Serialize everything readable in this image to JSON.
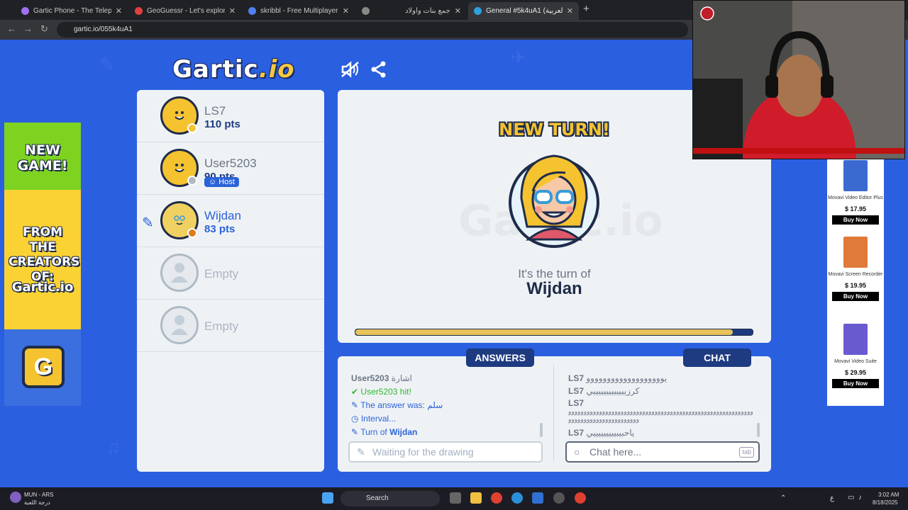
{
  "browser": {
    "tabs": [
      {
        "title": "Gartic Phone - The Telephone G",
        "color": "#a070f0"
      },
      {
        "title": "GeoGuessr - Let's explore the w",
        "color": "#e04040"
      },
      {
        "title": "skribbl - Free Multiplayer Draw",
        "color": "#5080f0"
      },
      {
        "title": "",
        "color": "#888888"
      },
      {
        "title": "جمع بنات وأولاد",
        "color": ""
      },
      {
        "title": "General #5k4uA1 (العربية) - Gar",
        "color": "#30a0e0"
      }
    ],
    "url": "gartic.io/055k4uA1"
  },
  "logo": {
    "text": "Gartic",
    "io": ".io"
  },
  "players": [
    {
      "name": "LS7",
      "points": "110 pts",
      "status_color": "#f5c230"
    },
    {
      "name": "User5203",
      "points": "90 pts",
      "status_color": "#b0b8c0",
      "badge": "Host"
    },
    {
      "name": "Wijdan",
      "points": "83 pts",
      "status_color": "#e07a1a"
    },
    {
      "name": "Empty"
    },
    {
      "name": "Empty"
    }
  ],
  "stage": {
    "headline": "NEW TURN!",
    "turn_of_label": "It's the turn of",
    "turn_player": "Wijdan",
    "progress_pct": 95
  },
  "answers": {
    "title": "ANSWERS",
    "messages": [
      {
        "user": "User5203",
        "text": "اشارة"
      },
      {
        "user": "User5203",
        "text": " hit!"
      },
      {
        "prefix": "The answer was: ",
        "value": "سلم"
      },
      {
        "text": "Interval..."
      },
      {
        "prefix": "Turn of ",
        "value": "Wijdan"
      }
    ],
    "placeholder": "Waiting for the drawing"
  },
  "chat": {
    "title": "CHAT",
    "messages": [
      {
        "user": "LS7",
        "text": "يووووووووووووووووووو"
      },
      {
        "user": "LS7",
        "text": "كرزيييييييييييييي"
      },
      {
        "user": "LS7",
        "text": "ووووووووووووووووووووووووووووووووووووووووووووووووووووووووووووووووووووووووووووووووووو"
      },
      {
        "user": "LS7",
        "text": "ياحبيبيييييييييي"
      }
    ],
    "placeholder": "Chat here...",
    "key_hint": "tab"
  },
  "ad_left": {
    "line1": "NEW GAME!",
    "line2": "FROM THE CREATORS OF:",
    "brand": "Gartic.io",
    "icon": "G"
  },
  "ad_right": {
    "products": [
      {
        "name": "Movavi Video Editor Plus",
        "price": "$ 17.95",
        "cta": "Buy Now",
        "color": "#3a6ad0"
      },
      {
        "name": "Movavi Screen Recorder",
        "price": "$ 19.95",
        "cta": "Buy Now",
        "color": "#e07a3a"
      },
      {
        "name": "Movavi Video Suite",
        "price": "$ 29.95",
        "cta": "Buy Now",
        "color": "#6a5ad0"
      }
    ]
  },
  "taskbar": {
    "weather_title": "MUN - ARS",
    "weather_sub": "درجة اللعبة",
    "search": "Search",
    "lang": "ع",
    "time": "3:02 AM",
    "date": "8/18/2025"
  }
}
